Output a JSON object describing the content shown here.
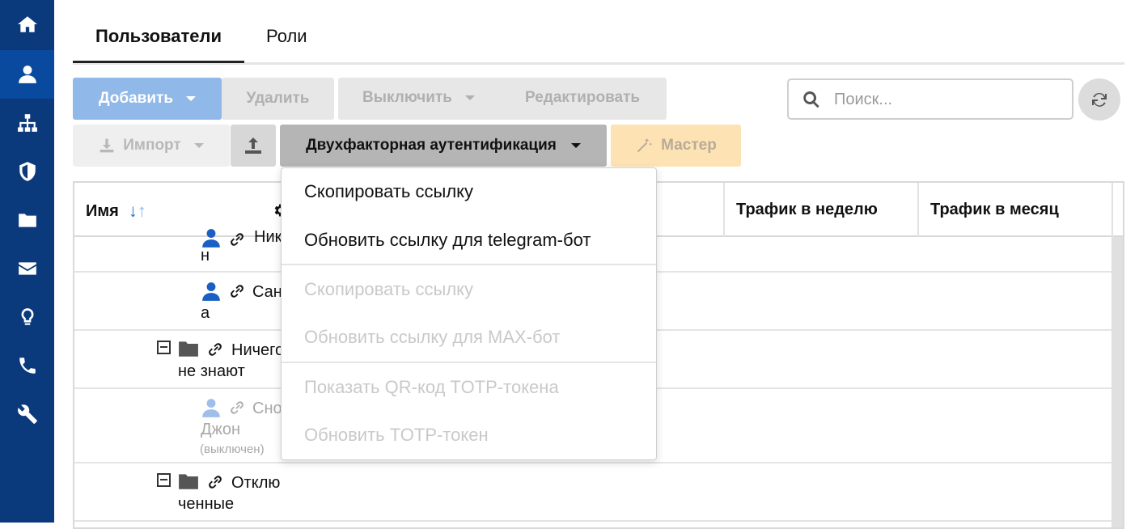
{
  "tabs": {
    "users": "Пользователи",
    "roles": "Роли"
  },
  "toolbar": {
    "add": "Добавить",
    "delete": "Удалить",
    "disable": "Выключить",
    "edit": "Редактировать",
    "import": "Импорт",
    "twofa": "Двухфакторная аутентификация",
    "wizard": "Мастер"
  },
  "search": {
    "placeholder": "Поиск..."
  },
  "table": {
    "col_name": "Имя",
    "col_week": "Трафик в неделю",
    "col_month": "Трафик в месяц",
    "rows": [
      {
        "text_line1": "Ник",
        "text_line2": "н"
      },
      {
        "text_line1": "Сан",
        "text_line2": "а"
      },
      {
        "text_line1": "Ничего",
        "text_line2": "не знают"
      },
      {
        "text_line1": "Сно",
        "text_line2": "Джон",
        "note": "(выключен)"
      },
      {
        "text_line1": "Отклю",
        "text_line2": "ченные"
      }
    ]
  },
  "menu": {
    "items": [
      {
        "label": "Скопировать ссылку",
        "enabled": true
      },
      {
        "label": "Обновить ссылку для telegram-бот",
        "enabled": true
      },
      {
        "label": "Скопировать ссылку",
        "enabled": false
      },
      {
        "label": "Обновить ссылку для MAX-бот",
        "enabled": false
      },
      {
        "label": "Показать QR-код TOTP-токена",
        "enabled": false
      },
      {
        "label": "Обновить TOTP-токен",
        "enabled": false
      }
    ]
  },
  "colors": {
    "sidebar": "#0b3a7c",
    "primary_disabled": "#90b8e8",
    "wizard": "#fde2b4"
  },
  "icons": [
    "home-icon",
    "user-icon",
    "sitemap-icon",
    "shield-icon",
    "folder-icon",
    "envelope-icon",
    "lightbulb-icon",
    "phone-icon",
    "wrench-icon"
  ]
}
